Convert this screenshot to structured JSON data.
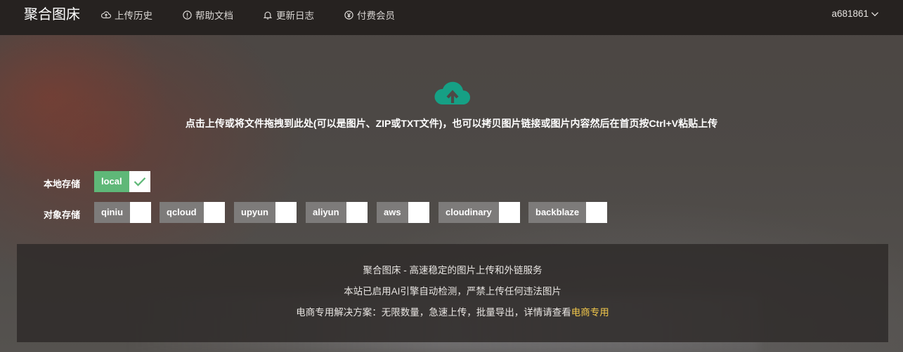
{
  "header": {
    "brand": "聚合图床",
    "nav": [
      {
        "label": "上传历史",
        "icon": "cloud-upload-icon"
      },
      {
        "label": "帮助文档",
        "icon": "info-circle-icon"
      },
      {
        "label": "更新日志",
        "icon": "bell-icon"
      },
      {
        "label": "付费会员",
        "icon": "yen-circle-icon"
      }
    ],
    "user": "a681861"
  },
  "upload": {
    "icon": "cloud-upload-icon",
    "hint": "点击上传或将文件拖拽到此处(可以是图片、ZIP或TXT文件)，也可以拷贝图片链接或图片内容然后在首页按Ctrl+V粘贴上传"
  },
  "storage": {
    "local_label": "本地存储",
    "local_options": [
      {
        "label": "local",
        "checked": true
      }
    ],
    "object_label": "对象存储",
    "object_options": [
      {
        "label": "qiniu",
        "checked": false
      },
      {
        "label": "qcloud",
        "checked": false
      },
      {
        "label": "upyun",
        "checked": false
      },
      {
        "label": "aliyun",
        "checked": false
      },
      {
        "label": "aws",
        "checked": false
      },
      {
        "label": "cloudinary",
        "checked": false
      },
      {
        "label": "backblaze",
        "checked": false
      }
    ]
  },
  "footer": {
    "line1": "聚合图床 - 高速稳定的图片上传和外链服务",
    "line2": "本站已启用AI引擎自动检测，严禁上传任何违法图片",
    "line3_text": "电商专用解决方案：无限数量，急速上传，批量导出，详情请查看",
    "line3_link": "电商专用"
  },
  "colors": {
    "accent_teal": "#16a085",
    "checked_green": "#5fb878",
    "link_yellow": "#f0c64b"
  }
}
